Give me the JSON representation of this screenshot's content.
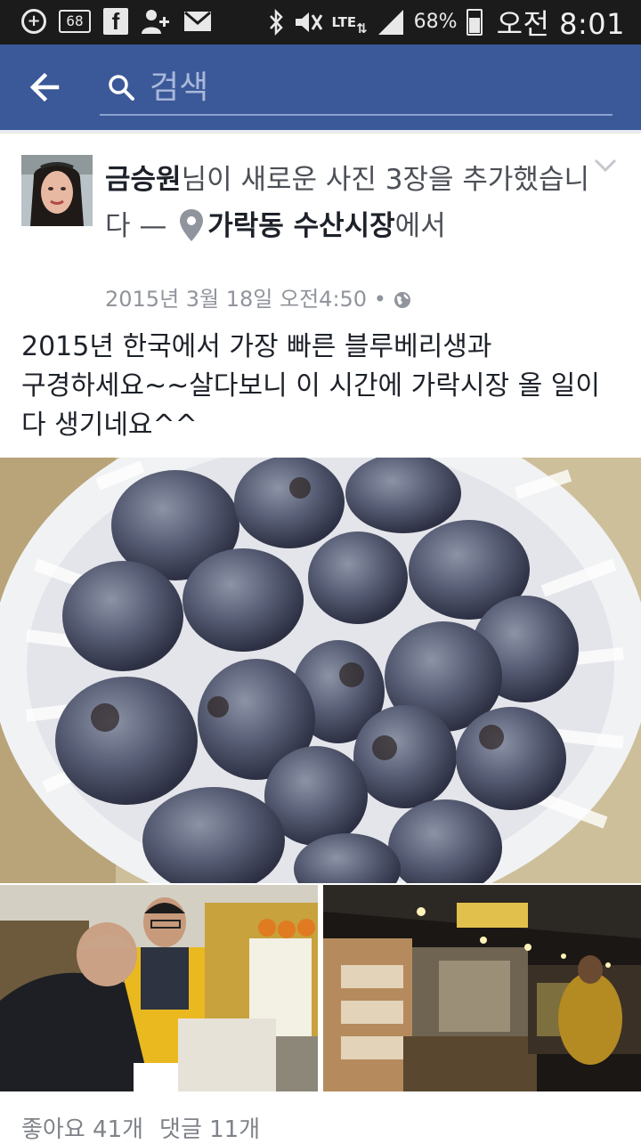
{
  "status_bar": {
    "calendar_day": "68",
    "network": "LTE",
    "battery_percent": "68%",
    "clock": "오전 8:01",
    "icons": [
      "plus-notification-icon",
      "calendar-icon",
      "facebook-icon",
      "add-friend-icon",
      "mail-icon",
      "bluetooth-icon",
      "mute-icon",
      "signal-icon",
      "battery-icon"
    ]
  },
  "app_bar": {
    "search_placeholder": "검색",
    "color": "#3b5998"
  },
  "post": {
    "author": "금승원",
    "action_part1": "님이 새로운 사진 3장을 추가했습니다 — ",
    "place": "가락동 수산시장",
    "action_part2": "에서",
    "timestamp": "2015년 3월 18일 오전4:50 •",
    "text": "2015년 한국에서 가장 빠른 블루베리생과\n구경하세요~~살다보니 이 시간에 가락시장 올 일이\n다 생기네요^^",
    "photos": [
      {
        "subject": "blueberries in white basket"
      },
      {
        "subject": "two men at market stall"
      },
      {
        "subject": "night market stalls"
      }
    ]
  },
  "footer": {
    "likes": "좋아요 41개",
    "comments": "댓글 11개"
  }
}
